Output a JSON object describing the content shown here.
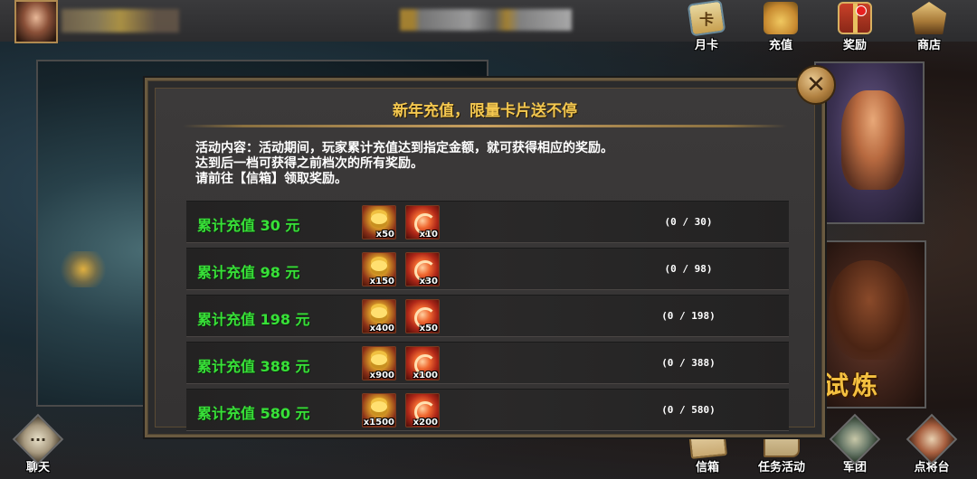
{
  "top_bar": {
    "buttons": [
      {
        "label": "月卡",
        "icon": "month-card-icon"
      },
      {
        "label": "充值",
        "icon": "recharge-icon"
      },
      {
        "label": "奖励",
        "icon": "gift-box-icon",
        "has_notification": true
      },
      {
        "label": "商店",
        "icon": "shop-icon"
      }
    ]
  },
  "background": {
    "banner_text": "试炼"
  },
  "dialog": {
    "title": "新年充值，限量卡片送不停",
    "close_symbol": "✕",
    "description": [
      "活动内容：活动期间，玩家累计充值达到指定金额，就可获得相应的奖励。",
      "达到后一档可获得之前档次的所有奖励。",
      "请前往【信箱】领取奖励。"
    ],
    "tiers": [
      {
        "label": "累计充值 30 元",
        "gold_qty": "x50",
        "card_qty": "x10",
        "progress": "(0 / 30)"
      },
      {
        "label": "累计充值 98 元",
        "gold_qty": "x150",
        "card_qty": "x30",
        "progress": "(0 / 98)"
      },
      {
        "label": "累计充值 198 元",
        "gold_qty": "x400",
        "card_qty": "x50",
        "progress": "(0 / 198)"
      },
      {
        "label": "累计充值 388 元",
        "gold_qty": "x900",
        "card_qty": "x100",
        "progress": "(0 / 388)"
      },
      {
        "label": "累计充值 580 元",
        "gold_qty": "x1500",
        "card_qty": "x200",
        "progress": "(0 / 580)"
      }
    ]
  },
  "bottom_bar": {
    "chat_label": "聊天",
    "buttons": [
      {
        "label": "信箱",
        "icon": "mailbox-icon"
      },
      {
        "label": "任务活动",
        "icon": "task-scroll-icon"
      },
      {
        "label": "军团",
        "icon": "legion-icon"
      },
      {
        "label": "点将台",
        "icon": "general-platform-icon"
      }
    ]
  },
  "colors": {
    "title_gold": "#f4c850",
    "tier_green": "#38e038",
    "dialog_bg": "#3c3a3a",
    "notification_red": "#e82020"
  }
}
